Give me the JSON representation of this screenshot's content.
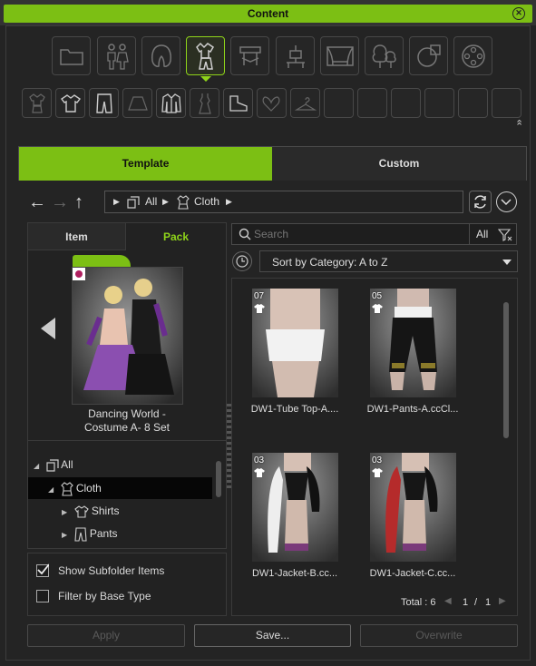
{
  "window": {
    "title": "Content",
    "close_icon": "close-icon"
  },
  "top_icons": [
    "folder-icon",
    "people-icon",
    "hair-icon",
    "cloth-icon",
    "furniture-icon",
    "stage-icon",
    "stage-set-icon",
    "tree-icon",
    "pie-icon",
    "media-icon"
  ],
  "active_top_icon": "cloth-icon",
  "sub_icons": [
    "cloth-all-icon",
    "shirt-icon",
    "pants-icon",
    "skirt-icon",
    "jacket-icon",
    "dress-icon",
    "shoes-icon",
    "gloves-icon",
    "hanger-icon",
    "",
    "",
    "",
    "",
    "",
    ""
  ],
  "tabs": {
    "template": "Template",
    "custom": "Custom"
  },
  "breadcrumb": {
    "all": "All",
    "cloth": "Cloth"
  },
  "left_tabs": {
    "item": "Item",
    "pack": "Pack"
  },
  "pack": {
    "title_line1": "Dancing World -",
    "title_line2": "Costume A- 8 Set"
  },
  "tree": [
    {
      "label": "All"
    },
    {
      "label": "Cloth"
    },
    {
      "label": "Shirts"
    },
    {
      "label": "Pants"
    }
  ],
  "options": {
    "show_subfolder": "Show Subfolder Items",
    "filter_base": "Filter by Base Type",
    "show_subfolder_checked": true,
    "filter_base_checked": false
  },
  "search": {
    "placeholder": "Search",
    "filter_label": "All"
  },
  "sort": {
    "label": "Sort by Category: A to Z"
  },
  "items": [
    {
      "num": "07",
      "label": "DW1-Tube Top-A...."
    },
    {
      "num": "05",
      "label": "DW1-Pants-A.ccCl..."
    },
    {
      "num": "03",
      "label": "DW1-Jacket-B.cc..."
    },
    {
      "num": "03",
      "label": "DW1-Jacket-C.cc..."
    }
  ],
  "pagination": {
    "total": "Total : 6",
    "current": "1",
    "separator": "/",
    "pages": "1"
  },
  "footer": {
    "apply": "Apply",
    "save": "Save...",
    "overwrite": "Overwrite"
  },
  "colors": {
    "accent": "#7cbf14",
    "background": "#242424"
  }
}
